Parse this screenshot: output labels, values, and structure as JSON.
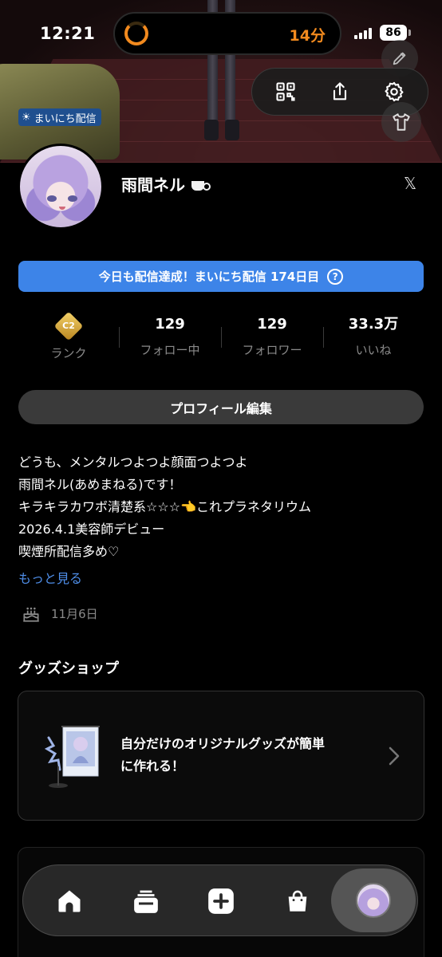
{
  "status_bar": {
    "time": "12:21",
    "timer": "14分",
    "battery": "86"
  },
  "cover": {
    "daily_tag": "まいにち配信"
  },
  "profile": {
    "name": "雨間ネル",
    "streak_banner": "今日も配信達成！まいにち配信 174日目",
    "streak_help": "?",
    "rank_label": "ランク",
    "rank_badge_text": "C2",
    "following_count": "129",
    "following_label": "フォロー中",
    "followers_count": "129",
    "followers_label": "フォロワー",
    "likes_count": "33.3万",
    "likes_label": "いいね",
    "edit_button": "プロフィール編集",
    "bio_lines": [
      "どうも、メンタルつよつよ顔面つよつよ",
      "雨間ネル(あめまねる)です！",
      "キラキラカワボ清楚系☆☆☆👈これプラネタリウム",
      "2026.4.1美容師デビュー",
      "喫煙所配信多め♡"
    ],
    "more_link": "もっと見る",
    "birthday": "11月6日"
  },
  "goods": {
    "section_title": "グッズショップ",
    "card_text_line1": "自分だけのオリジナルグッズが簡単",
    "card_text_line2": "に作れる！"
  },
  "colors": {
    "accent_blue": "#3d84e8",
    "link_blue": "#4f8ee8",
    "timer_orange": "#f28a1e",
    "rank_gold": "#e0b040"
  },
  "icons": {
    "qr": "qr-code-icon",
    "share": "share-icon",
    "settings": "gear-icon",
    "edit_cover": "pencil-icon",
    "outfit": "tshirt-icon",
    "x": "x-logo-icon",
    "birthday": "cake-icon",
    "chevron": "chevron-right-icon",
    "home": "home-icon",
    "feed": "card-stack-icon",
    "create": "plus-icon",
    "shop": "shopping-bag-icon"
  }
}
